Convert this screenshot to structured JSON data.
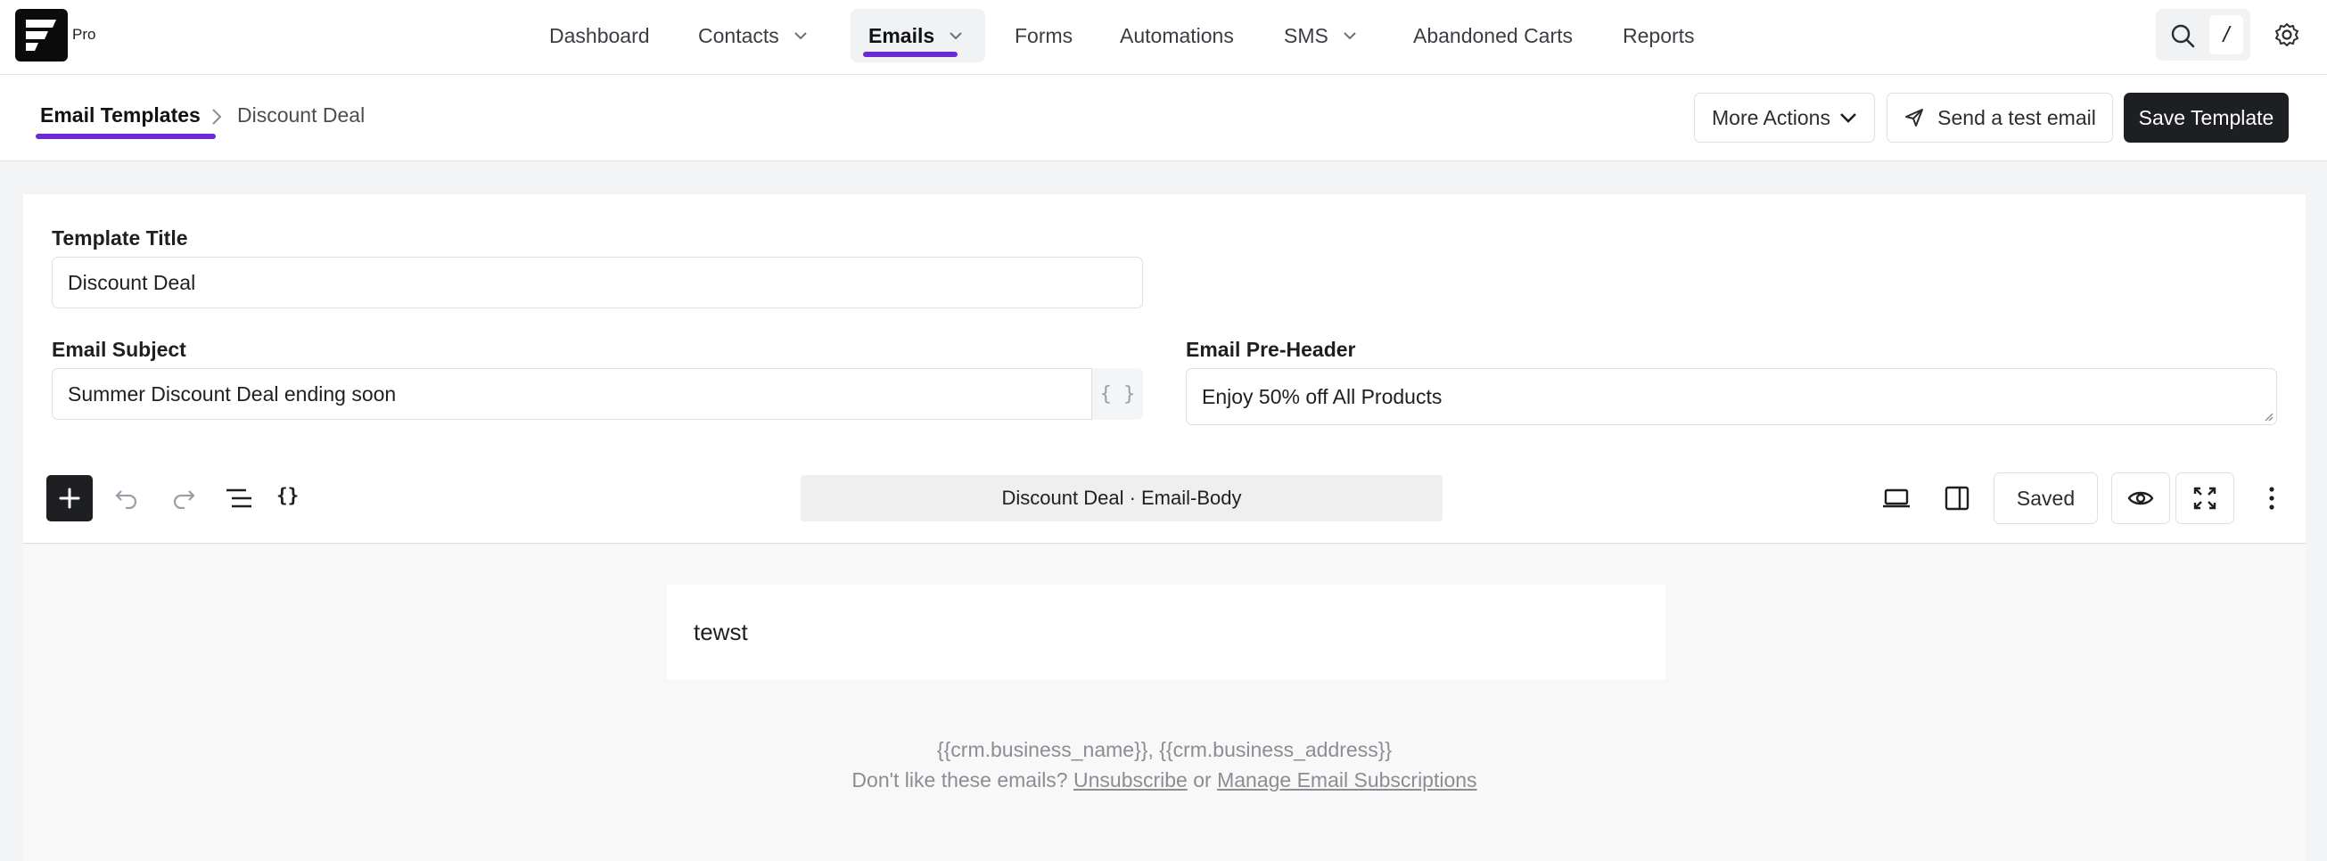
{
  "brand": {
    "badge": "Pro",
    "accent_color": "#6a2bd6"
  },
  "nav": {
    "items": [
      {
        "label": "Dashboard",
        "has_dropdown": false
      },
      {
        "label": "Contacts",
        "has_dropdown": true
      },
      {
        "label": "Emails",
        "has_dropdown": true,
        "active": true
      },
      {
        "label": "Forms",
        "has_dropdown": false
      },
      {
        "label": "Automations",
        "has_dropdown": false
      },
      {
        "label": "SMS",
        "has_dropdown": true
      },
      {
        "label": "Abandoned Carts",
        "has_dropdown": false
      },
      {
        "label": "Reports",
        "has_dropdown": false
      }
    ],
    "tools": {
      "search_icon": "search-icon",
      "shortcut": "/",
      "settings_icon": "gear-icon"
    }
  },
  "breadcrumb": {
    "parent": "Email Templates",
    "current": "Discount Deal"
  },
  "actions": {
    "more": "More Actions",
    "test": "Send a test email",
    "save": "Save Template"
  },
  "form": {
    "title_label": "Template Title",
    "title_value": "Discount Deal",
    "subject_label": "Email Subject",
    "subject_value": "Summer Discount Deal ending soon",
    "merge_tag": "{ }",
    "preheader_label": "Email Pre-Header",
    "preheader_value": "Enjoy 50% off All Products"
  },
  "editor": {
    "braces": "{}",
    "document_title": "Discount Deal · Email-Body",
    "saved_label": "Saved"
  },
  "canvas": {
    "body_text": "tewst",
    "footer_address": "{{crm.business_name}}, {{crm.business_address}}",
    "footer_prefix": "Don't like these emails?",
    "unsubscribe": "Unsubscribe",
    "or": "or",
    "manage": "Manage Email Subscriptions"
  }
}
